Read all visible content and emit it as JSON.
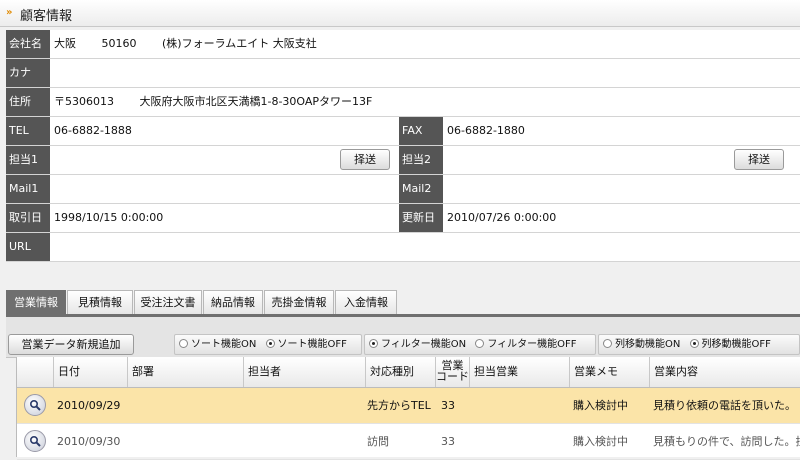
{
  "header": {
    "title": "顧客情報"
  },
  "customer": {
    "company_label": "会社名",
    "company_parts": [
      "大阪",
      "50160",
      "(株)フォーラムエイト 大阪支社"
    ],
    "kana_label": "カナ",
    "kana_value": "",
    "address_label": "住所",
    "postal": "〒5306013",
    "address": "大阪府大阪市北区天満橋1-8-30OAPタワー13F",
    "tel_label": "TEL",
    "tel_value": "06-6882-1888",
    "fax_label": "FAX",
    "fax_value": "06-6882-1880",
    "tanto1_label": "担当1",
    "tanto2_label": "担当2",
    "select_button": "择送",
    "mail1_label": "Mail1",
    "mail2_label": "Mail2",
    "start_label": "取引日",
    "start_value": "1998/10/15 0:00:00",
    "updated_label": "更新日",
    "updated_value": "2010/07/26 0:00:00",
    "url_label": "URL"
  },
  "tabs": [
    "営業情報",
    "見積情報",
    "受注注文書",
    "納品情報",
    "売掛金情報",
    "入金情報"
  ],
  "toolbar": {
    "add_button": "営業データ新規追加",
    "sort": {
      "on": "ソート機能ON",
      "off": "ソート機能OFF",
      "selected": "off"
    },
    "filter": {
      "on": "フィルター機能ON",
      "off": "フィルター機能OFF",
      "selected": "on"
    },
    "move": {
      "on": "列移動機能ON",
      "off": "列移動機能OFF",
      "selected": "off"
    }
  },
  "grid": {
    "columns": [
      "日付",
      "部署",
      "担当者",
      "対応種別",
      "営業コード",
      "担当営業",
      "営業メモ",
      "営業内容"
    ],
    "code_col_lines": [
      "営業",
      "コード"
    ],
    "rows": [
      {
        "date": "2010/09/29",
        "dept": "",
        "person": "",
        "type": "先方からTEL",
        "code": "33",
        "sales": "",
        "memo": "購入検討中",
        "content": "見積り依頼の電話を頂いた。"
      },
      {
        "date": "2010/09/30",
        "dept": "",
        "person": "",
        "type": "訪問",
        "code": "33",
        "sales": "",
        "memo": "購入検討中",
        "content": "見積もりの件で、訪問した。担"
      }
    ]
  }
}
